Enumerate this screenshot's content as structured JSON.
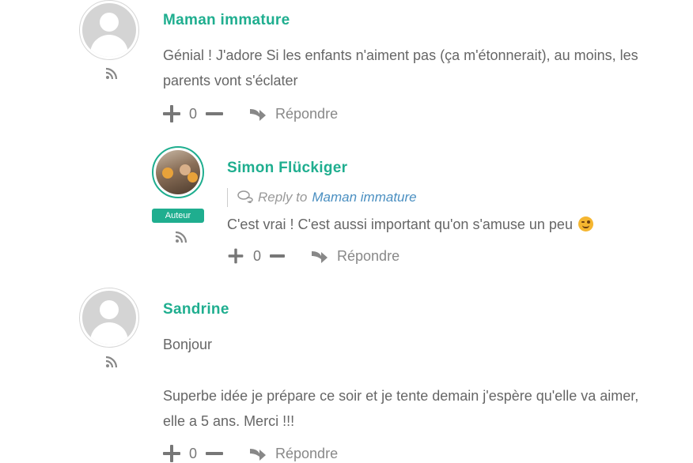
{
  "comments": [
    {
      "author": "Maman immature",
      "lines": [
        "Génial ! J'adore Si les enfants n'aiment pas (ça m'étonnerait), au moins, les",
        "parents vont s'éclater"
      ],
      "votes": "0",
      "reply_label": "Répondre"
    },
    {
      "author": "Simon Flückiger",
      "badge": "Auteur",
      "reply_to_prefix": "Reply to",
      "reply_to_target": "Maman immature",
      "text": "C'est vrai ! C'est aussi important qu'on s'amuse un peu",
      "emoji": "winking-face",
      "votes": "0",
      "reply_label": "Répondre"
    },
    {
      "author": "Sandrine",
      "lines": [
        "Bonjour",
        "",
        "Superbe idée je prépare ce soir et je tente demain j'espère qu'elle va aimer,",
        "elle a 5 ans. Merci !!!"
      ],
      "votes": "0",
      "reply_label": "Répondre"
    }
  ],
  "colors": {
    "accent": "#1fae8f",
    "link": "#4a8fc1",
    "text": "#666666"
  }
}
